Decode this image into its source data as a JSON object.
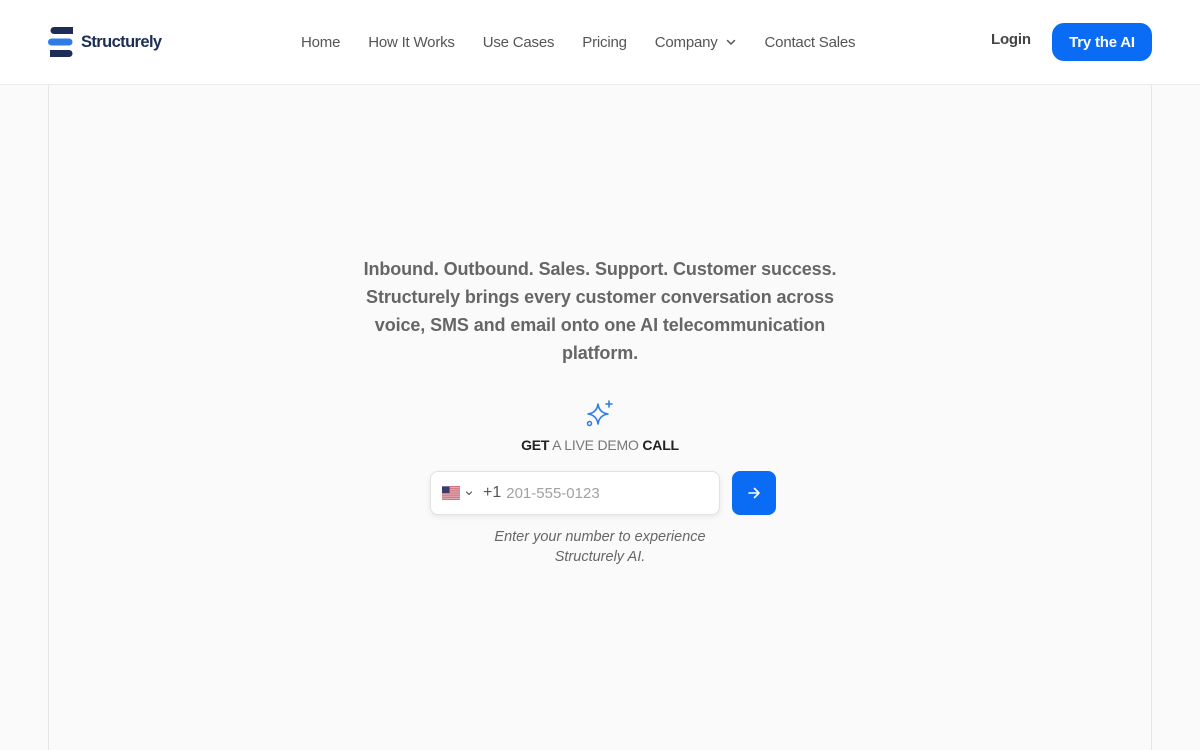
{
  "brand": {
    "name": "Structurely",
    "logo_icon": "structurely-logo-icon",
    "color": "#1d2d55"
  },
  "nav": {
    "items": [
      {
        "label": "Home"
      },
      {
        "label": "How It Works"
      },
      {
        "label": "Use Cases"
      },
      {
        "label": "Pricing"
      },
      {
        "label": "Company",
        "icon": "chevron-down-icon"
      },
      {
        "label": "Contact Sales"
      }
    ],
    "login_label": "Login",
    "cta_label": "Try the AI"
  },
  "hero": {
    "description": "Inbound. Outbound. Sales. Support. Customer success. Structurely brings every customer conversation across voice, SMS and email onto one AI telecommunication platform.",
    "sparkle_icon": "sparkle-icon",
    "demo_label": {
      "part1": "GET",
      "part2": " A LIVE DEMO ",
      "part3": "CALL"
    }
  },
  "phone_form": {
    "country_flag": "us-flag-icon",
    "dial_code": "+1",
    "placeholder": "201-555-0123",
    "value": "",
    "submit_icon": "arrow-right-icon",
    "hint": "Enter your number to experience Structurely AI."
  },
  "colors": {
    "accent": "#0a6cf5",
    "background": "#fafafa",
    "header_bg": "#ffffff"
  }
}
